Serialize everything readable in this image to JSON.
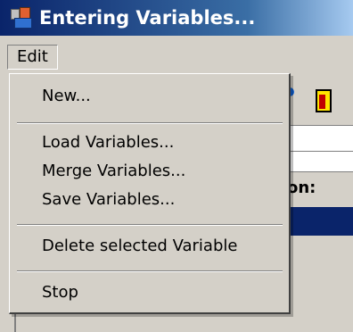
{
  "window": {
    "title": "Entering Variables...",
    "app_icon": "app-blocks-icon"
  },
  "menubar": {
    "edit_label": "Edit"
  },
  "background": {
    "label_partial": "on:",
    "exit_icon": "door-exit-icon"
  },
  "menu": {
    "items": [
      {
        "label": "New..."
      },
      {
        "label": "Load Variables..."
      },
      {
        "label": "Merge Variables..."
      },
      {
        "label": "Save Variables..."
      },
      {
        "label": "Delete selected Variable"
      },
      {
        "label": "Stop"
      }
    ]
  },
  "colors": {
    "title_gradient_start": "#0a246a",
    "title_gradient_end": "#a6caf0",
    "face": "#d4d0c8",
    "selection_blue": "#0a246a"
  }
}
